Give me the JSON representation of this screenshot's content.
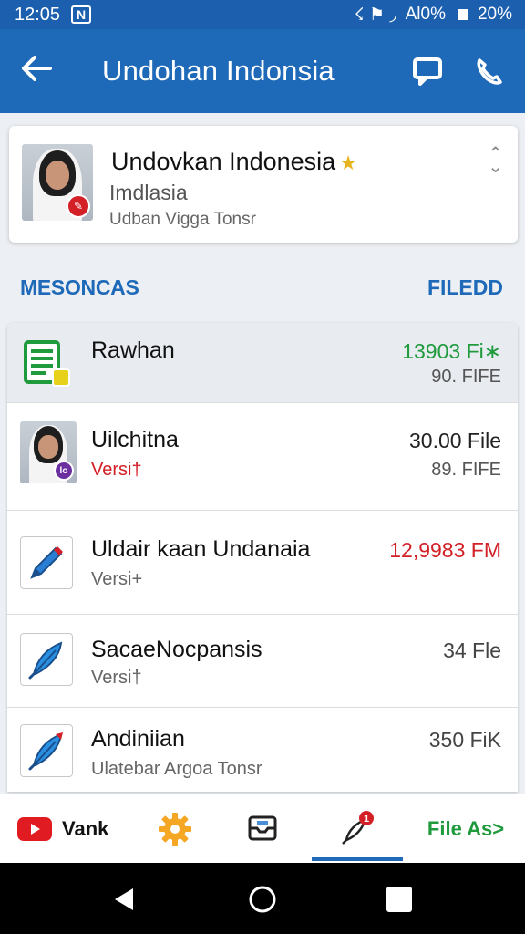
{
  "status_bar": {
    "time": "12:05",
    "notif_badge": "N",
    "icons_text": "☇ ⚑ ◞",
    "signal_text": "Аl0%",
    "battery_text": "20%"
  },
  "app_bar": {
    "title": "Undohan Indonsia",
    "back_icon": "back-arrow-icon",
    "chat_icon": "chat-icon",
    "phone_icon": "phone-icon"
  },
  "profile": {
    "name": "Undovkan Indonesia",
    "location": "Imdlasia",
    "detail": "Udban Vigga Tonsr"
  },
  "section": {
    "left_label": "MESONCAS",
    "right_label": "FILEDD"
  },
  "list": [
    {
      "title": "Rawhan",
      "subtitle": "",
      "right_primary": "13903 Fi∗",
      "right_secondary": "90. FIFE",
      "icon": "spreadsheet-icon"
    },
    {
      "title": "Uilchitna",
      "subtitle": "Versi†",
      "right_primary": "30.00 File",
      "right_secondary": "89. FIFE",
      "icon": "avatar-photo"
    },
    {
      "title": "Uldair kaan Undanaia",
      "subtitle": "Versi+",
      "right_primary": "12,9983 FM",
      "right_secondary": "",
      "icon": "pen-icon"
    },
    {
      "title": "SacaeNocpansis",
      "subtitle": "Versi†",
      "right_primary": "34 Fle",
      "right_secondary": "",
      "icon": "feather-pen-icon"
    },
    {
      "title": "Andiniian",
      "subtitle": "Ulatebar Argoa Tonsr",
      "right_primary": "350 FiK",
      "right_secondary": "",
      "icon": "feather-pen-icon"
    }
  ],
  "bottom_nav": {
    "item1_label": "Vank",
    "item5_label": "File As>",
    "notif_count": "1"
  },
  "colors": {
    "primary": "#1e6ab9",
    "status_bar": "#1b5fae",
    "green": "#1f9a3d",
    "red": "#d32027"
  }
}
